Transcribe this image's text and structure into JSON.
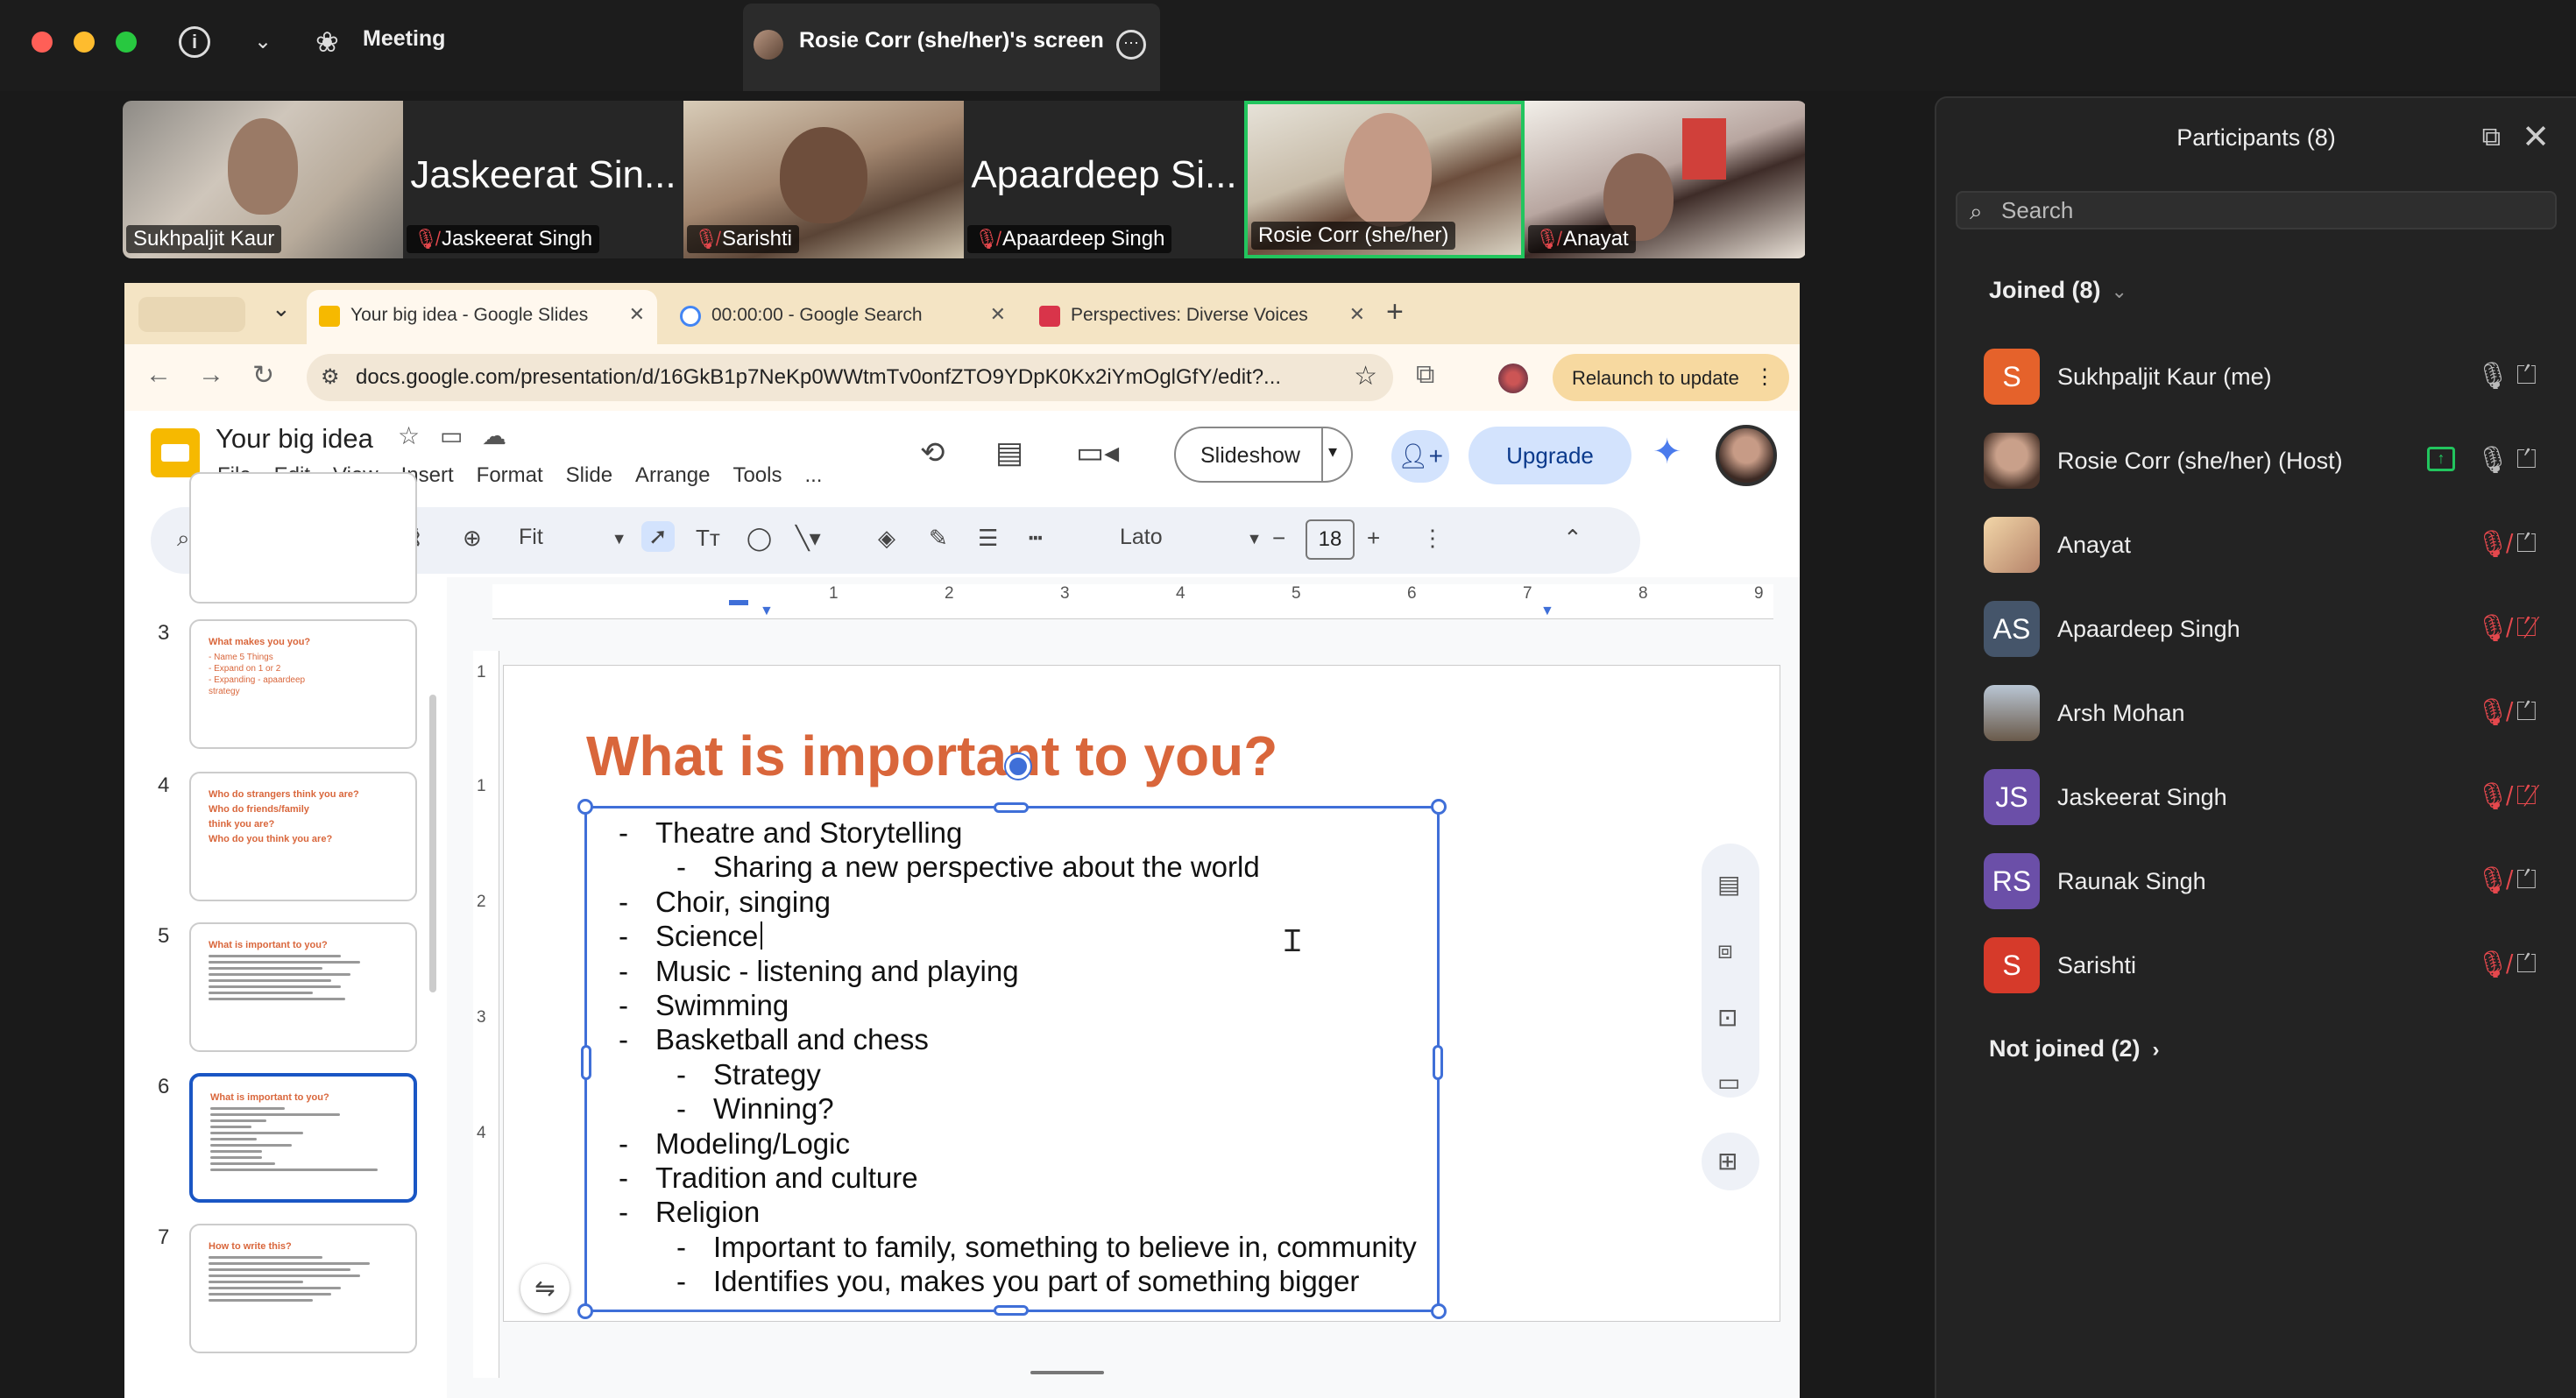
{
  "topbar": {
    "meeting_label": "Meeting",
    "screen_tab_label": "Rosie Corr (she/her)'s screen"
  },
  "gallery": [
    {
      "big_name": "",
      "name": "Sukhpaljit Kaur",
      "muted": false
    },
    {
      "big_name": "Jaskeerat Sin...",
      "name": "Jaskeerat Singh",
      "muted": true
    },
    {
      "big_name": "",
      "name": "Sarishti",
      "muted": true
    },
    {
      "big_name": "Apaardeep Si...",
      "name": "Apaardeep Singh",
      "muted": true
    },
    {
      "big_name": "",
      "name": "Rosie Corr (she/her)",
      "muted": false,
      "active_speaker": true
    },
    {
      "big_name": "",
      "name": "Anayat",
      "muted": true
    }
  ],
  "browser": {
    "tabs": [
      {
        "label": "Your big idea - Google Slides",
        "active": true
      },
      {
        "label": "00:00:00 - Google Search",
        "active": false
      },
      {
        "label": "Perspectives: Diverse Voices",
        "active": false
      }
    ],
    "url": "docs.google.com/presentation/d/16GkB1p7NeKp0WWtmTv0onfZTO9YDpK0Kx2iYmOglGfY/edit?...",
    "relaunch_label": "Relaunch to update"
  },
  "slides_app": {
    "doc_title": "Your big idea",
    "menus": [
      "File",
      "Edit",
      "View",
      "Insert",
      "Format",
      "Slide",
      "Arrange",
      "Tools",
      "..."
    ],
    "slideshow_label": "Slideshow",
    "upgrade_label": "Upgrade",
    "zoom_label": "Fit",
    "font_name": "Lato",
    "font_size": "18",
    "ruler_h": [
      "1",
      "2",
      "3",
      "4",
      "5",
      "6",
      "7",
      "8",
      "9"
    ],
    "ruler_v": [
      "1",
      "1",
      "2",
      "3",
      "4"
    ]
  },
  "thumbnails": [
    {
      "num": "3",
      "title": "What makes you you?",
      "lines": [
        "- Name 5 Things",
        "- Expand on 1 or 2",
        "- Expanding - apaardeep",
        "  strategy",
        "-"
      ]
    },
    {
      "num": "4",
      "title": "Who do strangers think you are?",
      "lines": [
        "Who do friends/family",
        "think you are?",
        "Who do you think you are?"
      ]
    },
    {
      "num": "5",
      "title": "What is important to you?",
      "lines": []
    },
    {
      "num": "6",
      "title": "What is important to you?",
      "lines": [],
      "selected": true
    },
    {
      "num": "7",
      "title": "How to write this?",
      "lines": []
    }
  ],
  "slide": {
    "title": "What is important to you?",
    "bullets": [
      {
        "text": "Theatre and Storytelling",
        "level": 1
      },
      {
        "text": "Sharing a new perspective about the world",
        "level": 2
      },
      {
        "text": "Choir, singing",
        "level": 1
      },
      {
        "text": "Science",
        "level": 1
      },
      {
        "text": "Music - listening and playing",
        "level": 1
      },
      {
        "text": "Swimming",
        "level": 1
      },
      {
        "text": "Basketball and chess",
        "level": 1
      },
      {
        "text": "Strategy",
        "level": 2
      },
      {
        "text": "Winning?",
        "level": 2
      },
      {
        "text": "Modeling/Logic",
        "level": 1
      },
      {
        "text": "Tradition and culture",
        "level": 1
      },
      {
        "text": "Religion",
        "level": 1
      },
      {
        "text": "Important to family, something to believe in, community",
        "level": 2
      },
      {
        "text": "Identifies you, makes you part of something bigger",
        "level": 2
      }
    ],
    "bullet_marker": "-"
  },
  "participants": {
    "title": "Participants (8)",
    "search_placeholder": "Search",
    "joined_label": "Joined (8)",
    "not_joined_label": "Not joined (2)",
    "list": [
      {
        "initials": "S",
        "name": "Sukhpaljit Kaur (me)",
        "color": "#e5622b",
        "mic_muted": false,
        "cam_off": false,
        "photo": false
      },
      {
        "initials": "",
        "name": "Rosie Corr (she/her) (Host)",
        "color": "#8a6a58",
        "mic_muted": false,
        "cam_off": false,
        "photo": true,
        "sharing": true
      },
      {
        "initials": "",
        "name": "Anayat",
        "color": "#c9a882",
        "mic_muted": true,
        "cam_off": false,
        "photo": true
      },
      {
        "initials": "AS",
        "name": "Apaardeep Singh",
        "color": "#45556a",
        "mic_muted": true,
        "cam_off": true,
        "photo": false
      },
      {
        "initials": "",
        "name": "Arsh Mohan",
        "color": "#6a7a8a",
        "mic_muted": true,
        "cam_off": false,
        "photo": true
      },
      {
        "initials": "JS",
        "name": "Jaskeerat Singh",
        "color": "#6b4fa8",
        "mic_muted": true,
        "cam_off": true,
        "photo": false
      },
      {
        "initials": "RS",
        "name": "Raunak Singh",
        "color": "#6b4fa8",
        "mic_muted": true,
        "cam_off": false,
        "photo": false
      },
      {
        "initials": "S",
        "name": "Sarishti",
        "color": "#d63a2a",
        "mic_muted": true,
        "cam_off": false,
        "photo": false
      }
    ]
  },
  "colors": {
    "accent_orange": "#d9663b",
    "selection_blue": "#3f6fd8",
    "muted_red": "#e5484d",
    "active_green": "#22c55e"
  }
}
